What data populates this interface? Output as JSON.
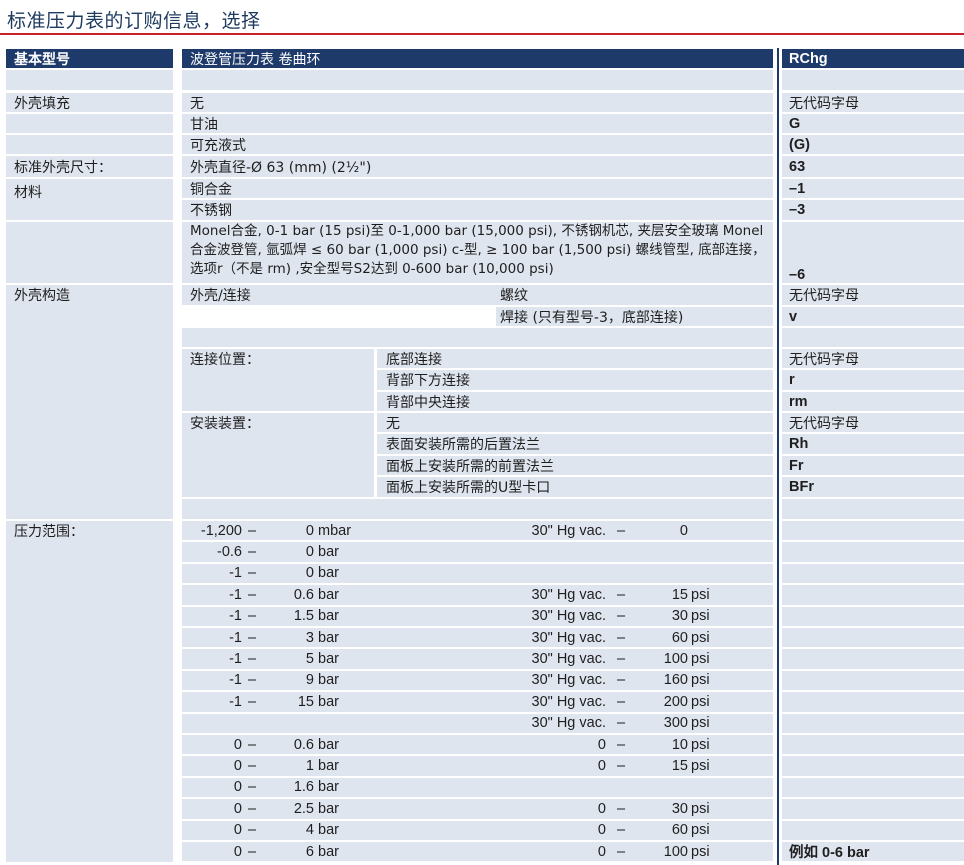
{
  "page": {
    "title": "标准压力表的订购信息，选择"
  },
  "header": {
    "label": "基本型号",
    "description": "波登管压力表 卷曲环",
    "code": "RChg"
  },
  "case_fill": {
    "label": "外壳填充",
    "options": [
      {
        "desc": "无",
        "code": "无代码字母"
      },
      {
        "desc": "甘油",
        "code": "G"
      },
      {
        "desc": "可充液式",
        "code": "(G)"
      }
    ]
  },
  "case_size": {
    "label": "标准外壳尺寸：",
    "desc": "外壳直径-Ø 63  (mm) (2½\")",
    "code": "63"
  },
  "material": {
    "label": "材料",
    "options": [
      {
        "desc": "铜合金",
        "code": "–1"
      },
      {
        "desc": "不锈钢",
        "code": "–3"
      }
    ],
    "monel_desc": "Monel合金, 0-1 bar (15 psi)至 0-1,000 bar (15,000 psi), 不锈钢机芯, 夹层安全玻璃 Monel合金波登管, 氩弧焊 ≤ 60 bar (1,000 psi) c-型, ≥ 100 bar (1,500 psi) 螺线管型, 底部连接，选项r（不是 rm) ,安全型号S2达到 0-600 bar (10,000 psi)",
    "monel_code": "–6"
  },
  "case_construction": {
    "label": "外壳构造",
    "sub_label": "外壳/连接",
    "options": [
      {
        "desc": "螺纹",
        "code": "无代码字母"
      },
      {
        "desc": "焊接 (只有型号-3，底部连接)",
        "code": "v"
      }
    ]
  },
  "connection_position": {
    "label": "连接位置：",
    "options": [
      {
        "desc": "底部连接",
        "code": "无代码字母"
      },
      {
        "desc": "背部下方连接",
        "code": "r"
      },
      {
        "desc": "背部中央连接",
        "code": "rm"
      }
    ]
  },
  "mounting": {
    "label": "安装装置：",
    "options": [
      {
        "desc": "无",
        "code": "无代码字母"
      },
      {
        "desc": "表面安装所需的后置法兰",
        "code": "Rh"
      },
      {
        "desc": "面板上安装所需的前置法兰",
        "code": "Fr"
      },
      {
        "desc": " 面板上安装所需的U型卡口",
        "code": "BFr"
      }
    ]
  },
  "pressure_range": {
    "label": "压力范围：",
    "rows": [
      {
        "from": "-1,200",
        "dash": "–",
        "to": "0",
        "unit": "mbar",
        "hg_from": "30\" Hg vac.",
        "hg_dash": "–",
        "hg_to": "0",
        "hg_unit": "",
        "code": ""
      },
      {
        "from": "-0.6",
        "dash": "–",
        "to": "0",
        "unit": "bar",
        "hg_from": "",
        "hg_dash": "",
        "hg_to": "",
        "hg_unit": "",
        "code": ""
      },
      {
        "from": "-1",
        "dash": "–",
        "to": "0",
        "unit": "bar",
        "hg_from": "",
        "hg_dash": "",
        "hg_to": "",
        "hg_unit": "",
        "code": ""
      },
      {
        "from": "-1",
        "dash": "–",
        "to": "0.6",
        "unit": "bar",
        "hg_from": "30\" Hg vac.",
        "hg_dash": "–",
        "hg_to": "15",
        "hg_unit": "psi",
        "code": ""
      },
      {
        "from": "-1",
        "dash": "–",
        "to": "1.5",
        "unit": "bar",
        "hg_from": "30\" Hg vac.",
        "hg_dash": "–",
        "hg_to": "30",
        "hg_unit": "psi",
        "code": ""
      },
      {
        "from": "-1",
        "dash": "–",
        "to": "3",
        "unit": "bar",
        "hg_from": "30\" Hg vac.",
        "hg_dash": "–",
        "hg_to": "60",
        "hg_unit": "psi",
        "code": ""
      },
      {
        "from": "-1",
        "dash": "–",
        "to": "5",
        "unit": "bar",
        "hg_from": "30\" Hg vac.",
        "hg_dash": "–",
        "hg_to": "100",
        "hg_unit": "psi",
        "code": ""
      },
      {
        "from": "-1",
        "dash": "–",
        "to": "9",
        "unit": "bar",
        "hg_from": "30\" Hg vac.",
        "hg_dash": "–",
        "hg_to": "160",
        "hg_unit": "psi",
        "code": ""
      },
      {
        "from": "-1",
        "dash": "–",
        "to": "15",
        "unit": "bar",
        "hg_from": "30\" Hg vac.",
        "hg_dash": "–",
        "hg_to": "200",
        "hg_unit": "psi",
        "code": ""
      },
      {
        "from": "",
        "dash": "",
        "to": "",
        "unit": "",
        "hg_from": "30\" Hg vac.",
        "hg_dash": "–",
        "hg_to": "300",
        "hg_unit": "psi",
        "code": ""
      },
      {
        "from": "0",
        "dash": "–",
        "to": "0.6",
        "unit": "bar",
        "hg_from": "0",
        "hg_dash": "–",
        "hg_to": "10",
        "hg_unit": "psi",
        "code": ""
      },
      {
        "from": "0",
        "dash": "–",
        "to": "1",
        "unit": "bar",
        "hg_from": "0",
        "hg_dash": "–",
        "hg_to": "15",
        "hg_unit": "psi",
        "code": ""
      },
      {
        "from": "0",
        "dash": "–",
        "to": "1.6",
        "unit": "bar",
        "hg_from": "",
        "hg_dash": "",
        "hg_to": "",
        "hg_unit": "",
        "code": ""
      },
      {
        "from": "0",
        "dash": "–",
        "to": "2.5",
        "unit": "bar",
        "hg_from": "0",
        "hg_dash": "–",
        "hg_to": "30",
        "hg_unit": "psi",
        "code": ""
      },
      {
        "from": "0",
        "dash": "–",
        "to": "4",
        "unit": "bar",
        "hg_from": "0",
        "hg_dash": "–",
        "hg_to": "60",
        "hg_unit": "psi",
        "code": ""
      },
      {
        "from": "0",
        "dash": "–",
        "to": "6",
        "unit": "bar",
        "hg_from": "0",
        "hg_dash": "–",
        "hg_to": "100",
        "hg_unit": "psi",
        "code": "例如 0-6 bar"
      }
    ]
  }
}
